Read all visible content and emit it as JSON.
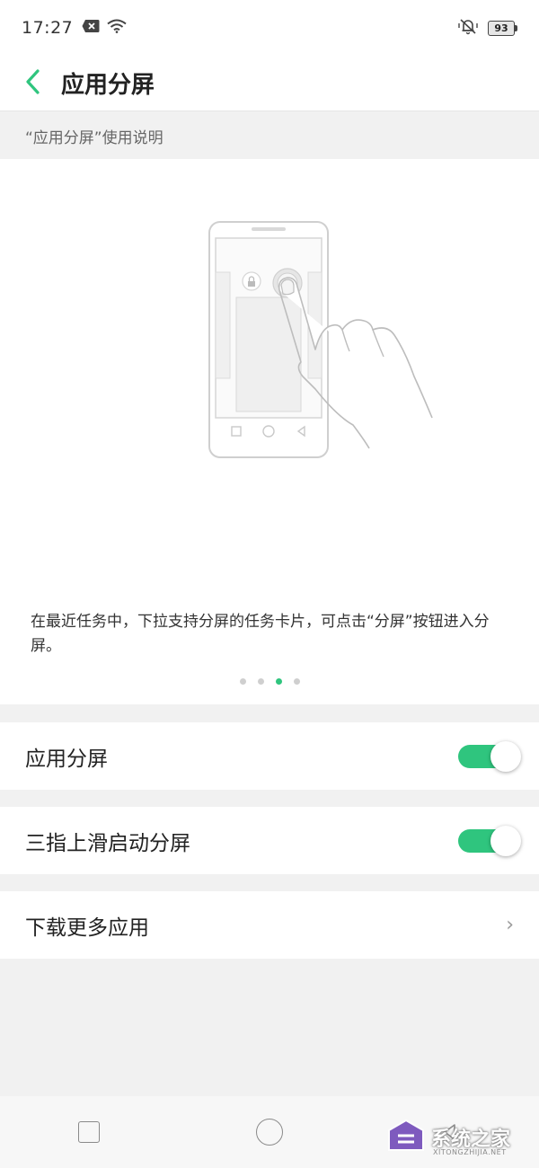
{
  "status_bar": {
    "time": "17:27",
    "battery_level": "93",
    "icons": [
      "notification-x-icon",
      "wifi-icon",
      "vibrate-icon",
      "battery-icon"
    ]
  },
  "header": {
    "title": "应用分屏",
    "back_icon": "chevron-left-icon"
  },
  "guide": {
    "caption": "“应用分屏”使用说明",
    "description": "在最近任务中，下拉支持分屏的任务卡片，可点击“分屏”按钮进入分屏。",
    "page_indicator": {
      "count": 4,
      "active_index": 2
    }
  },
  "settings": [
    {
      "label": "应用分屏",
      "type": "toggle",
      "enabled": true
    },
    {
      "label": "三指上滑启动分屏",
      "type": "toggle",
      "enabled": true
    },
    {
      "label": "下载更多应用",
      "type": "link",
      "chevron": "›"
    }
  ],
  "nav_bar": {
    "icons": [
      "recents-square-icon",
      "home-circle-icon",
      "back-triangle-icon"
    ]
  },
  "watermark": {
    "text": "系统之家",
    "sub": "XITONGZHIJIA.NET"
  },
  "colors": {
    "accent": "#2fc57e",
    "background": "#f1f1f1",
    "card": "#ffffff"
  }
}
